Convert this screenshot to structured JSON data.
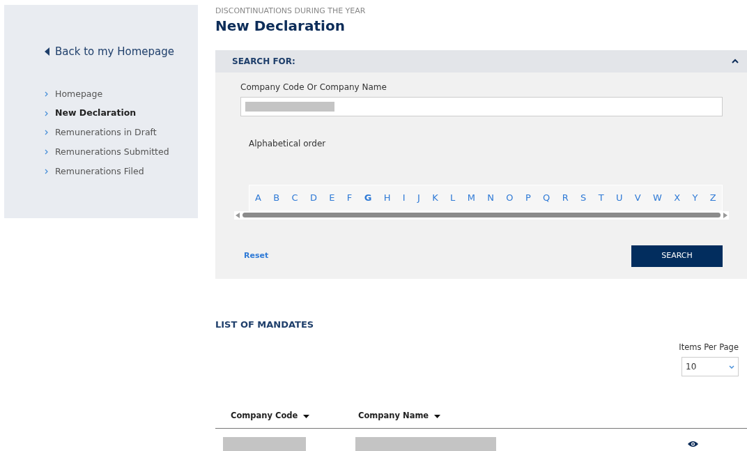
{
  "sidebar": {
    "back_link": "Back to my Homepage",
    "items": [
      {
        "label": "Homepage",
        "selected": false
      },
      {
        "label": "New Declaration",
        "selected": true
      },
      {
        "label": "Remunerations in Draft",
        "selected": false
      },
      {
        "label": "Remunerations Submitted",
        "selected": false
      },
      {
        "label": "Remunerations Filed",
        "selected": false
      }
    ]
  },
  "header": {
    "overline": "DISCONTINUATIONS DURING THE YEAR",
    "title": "New Declaration"
  },
  "search_panel": {
    "title": "SEARCH FOR:",
    "expanded": true,
    "field_label": "Company Code Or Company Name",
    "alphabet_label": "Alphabetical order",
    "letters": [
      {
        "label": "A",
        "selected": false
      },
      {
        "label": "B",
        "selected": false
      },
      {
        "label": "C",
        "selected": false
      },
      {
        "label": "D",
        "selected": false
      },
      {
        "label": "E",
        "selected": false
      },
      {
        "label": "F",
        "selected": false
      },
      {
        "label": "G",
        "selected": true
      },
      {
        "label": "H",
        "selected": false
      },
      {
        "label": "I",
        "selected": false
      },
      {
        "label": "J",
        "selected": false
      },
      {
        "label": "K",
        "selected": false
      },
      {
        "label": "L",
        "selected": false
      },
      {
        "label": "M",
        "selected": false
      },
      {
        "label": "N",
        "selected": false
      },
      {
        "label": "O",
        "selected": false
      },
      {
        "label": "P",
        "selected": false
      },
      {
        "label": "Q",
        "selected": false
      },
      {
        "label": "R",
        "selected": false
      },
      {
        "label": "S",
        "selected": false
      },
      {
        "label": "T",
        "selected": false
      },
      {
        "label": "U",
        "selected": false
      },
      {
        "label": "V",
        "selected": false
      },
      {
        "label": "W",
        "selected": false
      },
      {
        "label": "X",
        "selected": false
      },
      {
        "label": "Y",
        "selected": false
      },
      {
        "label": "Z",
        "selected": false
      }
    ],
    "reset": "Reset",
    "search_button": "SEARCH"
  },
  "mandates": {
    "title": "LIST OF MANDATES",
    "items_per_page_label": "Items Per Page",
    "items_per_page": "10",
    "columns": [
      "Company Code",
      "Company Name"
    ]
  }
}
